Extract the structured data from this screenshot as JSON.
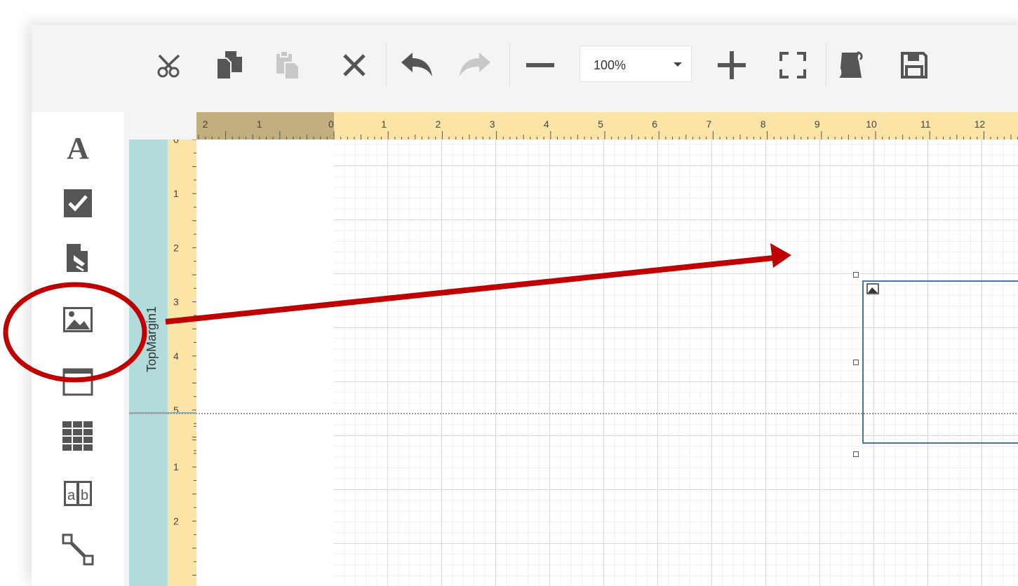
{
  "toolbar": {
    "buttons": [
      {
        "name": "cut",
        "icon": "scissors-icon",
        "enabled": true
      },
      {
        "name": "copy",
        "icon": "copy-icon",
        "enabled": true
      },
      {
        "name": "paste",
        "icon": "paste-icon",
        "enabled": false
      },
      {
        "name": "delete",
        "icon": "close-icon",
        "enabled": true
      },
      {
        "name": "undo",
        "icon": "undo-icon",
        "enabled": true
      },
      {
        "name": "redo",
        "icon": "redo-icon",
        "enabled": false
      },
      {
        "name": "zoom-out",
        "icon": "minus-icon",
        "enabled": true
      },
      {
        "name": "zoom-in",
        "icon": "plus-icon",
        "enabled": true
      },
      {
        "name": "fit",
        "icon": "fullscreen-icon",
        "enabled": true
      },
      {
        "name": "scripts",
        "icon": "scroll-icon",
        "enabled": true
      },
      {
        "name": "save",
        "icon": "save-icon",
        "enabled": true
      }
    ],
    "zoom": {
      "value": "100%"
    }
  },
  "toolbox": {
    "items": [
      {
        "name": "label",
        "icon": "text-a-icon"
      },
      {
        "name": "checkbox",
        "icon": "checkbox-icon"
      },
      {
        "name": "rich-text",
        "icon": "rich-text-icon"
      },
      {
        "name": "picture-box",
        "icon": "picture-icon",
        "highlighted": true
      },
      {
        "name": "panel",
        "icon": "panel-icon"
      },
      {
        "name": "table",
        "icon": "table-icon"
      },
      {
        "name": "character-comb",
        "icon": "character-comb-icon"
      },
      {
        "name": "line",
        "icon": "line-icon"
      }
    ]
  },
  "surface": {
    "band_label": "TopMargin1",
    "h_ruler_margin_labels": [
      "2",
      "1",
      "0"
    ],
    "h_ruler_labels": [
      "1",
      "2",
      "3",
      "4",
      "5",
      "6",
      "7",
      "8",
      "9",
      "10",
      "11",
      "12"
    ],
    "v_ruler_labels_band1": [
      "0",
      "1",
      "2",
      "3",
      "4",
      "5"
    ],
    "v_ruler_labels_band2": [
      "1",
      "2"
    ]
  },
  "colors": {
    "ruler": "#fce3a6",
    "ruler_margin": "#c2ad7f",
    "band_strip": "#b1dcdb",
    "selection": "#3e76ad",
    "annotation": "#c00000",
    "icon": "#555555",
    "icon_disabled": "#c8c8c8"
  }
}
